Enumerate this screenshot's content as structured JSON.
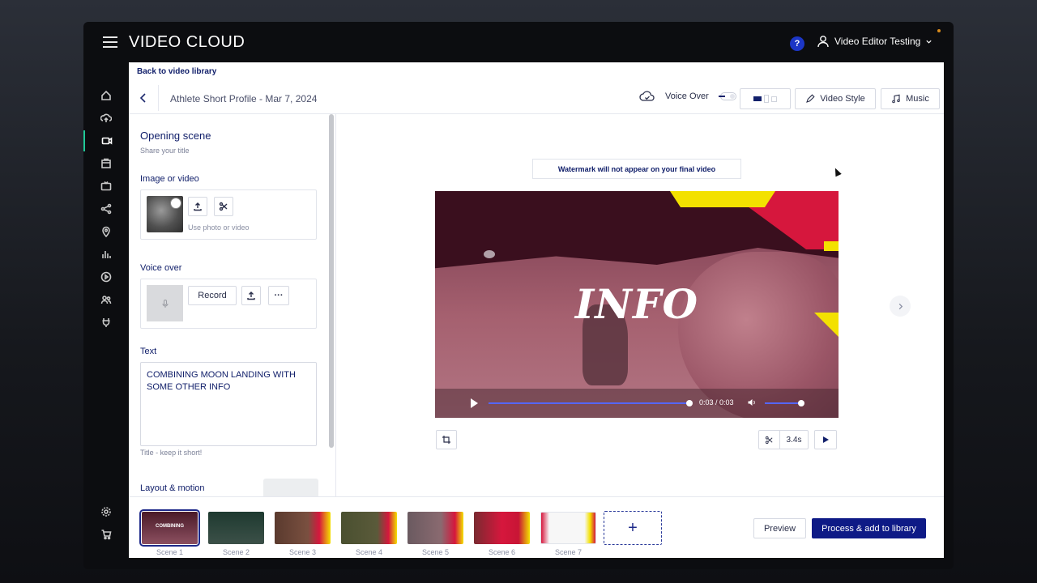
{
  "app": {
    "brand": "VIDEO CLOUD",
    "help_label": "?",
    "user_name": "Video Editor Testing"
  },
  "nav_rail": {
    "icons": [
      "home-icon",
      "upload-icon",
      "video-camera-icon",
      "media-icon",
      "tv-icon",
      "share-icon",
      "location-icon",
      "analytics-icon",
      "play-circle-icon",
      "users-icon",
      "plug-icon",
      "settings-icon",
      "cart-icon"
    ],
    "active": "video-camera-icon"
  },
  "editor": {
    "back_link": "Back to video library",
    "project_title": "Athlete Short Profile - Mar 7, 2024",
    "voice_over_label": "Voice Over",
    "video_style_label": "Video Style",
    "music_label": "Music"
  },
  "left_panel": {
    "scene_title": "Opening scene",
    "scene_subtitle": "Share your title",
    "image_section": "Image or video",
    "image_hint": "Use photo or video",
    "voice_section": "Voice over",
    "record_label": "Record",
    "more_label": "···",
    "text_section": "Text",
    "text_value": "COMBINING MOON LANDING WITH SOME OTHER INFO",
    "text_hint": "Title - keep it short!",
    "layout_section": "Layout & motion"
  },
  "stage": {
    "watermark_notice": "Watermark will not appear on your final video",
    "video_title": "INFO",
    "time": "0:03 / 0:03",
    "trim_duration": "3.4s"
  },
  "scenes": [
    {
      "label": "Scene 1",
      "caption": "COMBINING"
    },
    {
      "label": "Scene 2"
    },
    {
      "label": "Scene 3"
    },
    {
      "label": "Scene 4"
    },
    {
      "label": "Scene 5"
    },
    {
      "label": "Scene 6"
    },
    {
      "label": "Scene 7"
    }
  ],
  "footer": {
    "add_label": "+",
    "preview_label": "Preview",
    "process_label": "Process & add to library"
  },
  "colors": {
    "accent": "#0e1a86",
    "active_indicator": "#20c997",
    "brand_red": "#d6173d",
    "brand_yellow": "#f3e100"
  }
}
